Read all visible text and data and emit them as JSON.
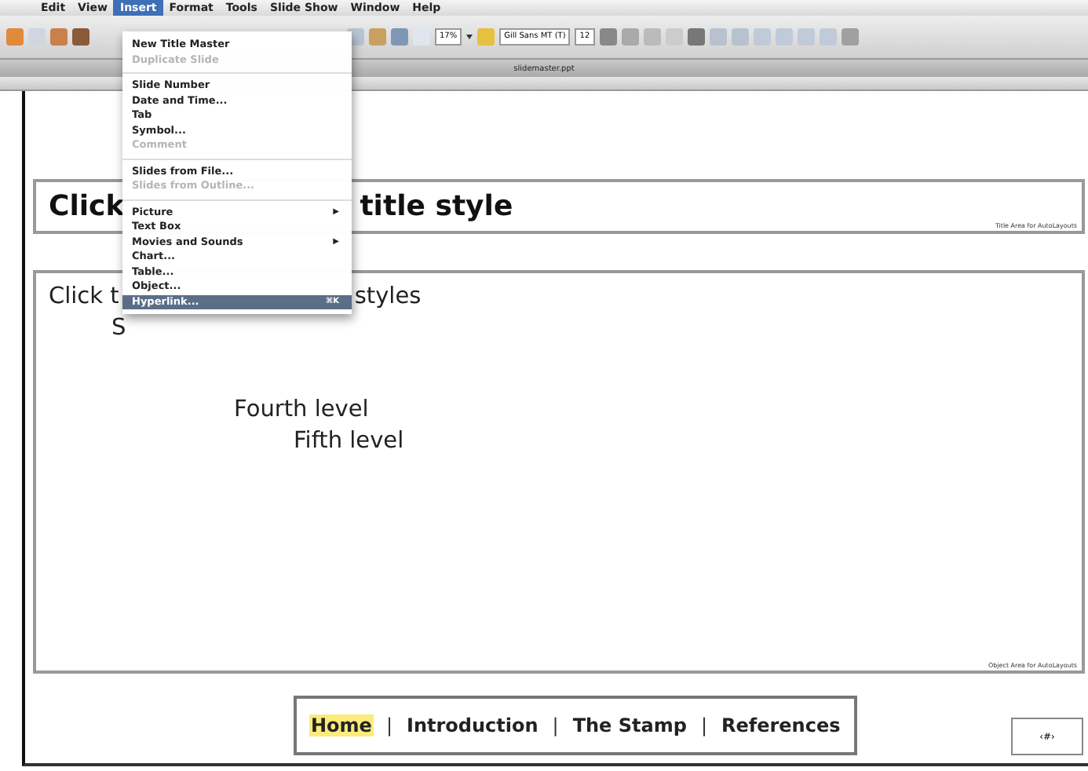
{
  "menubar": [
    {
      "label": "Edit",
      "selected": false
    },
    {
      "label": "View",
      "selected": false
    },
    {
      "label": "Insert",
      "selected": true
    },
    {
      "label": "Format",
      "selected": false
    },
    {
      "label": "Tools",
      "selected": false
    },
    {
      "label": "Slide Show",
      "selected": false
    },
    {
      "label": "Window",
      "selected": false
    },
    {
      "label": "Help",
      "selected": false
    }
  ],
  "toolbar": {
    "zoom": "17%",
    "font": "Gill Sans MT (T)",
    "size": "12"
  },
  "document_title": "slidemaster.ppt",
  "insert_menu": [
    {
      "kind": "item",
      "label": "New Title Master",
      "disabled": false,
      "selected": false
    },
    {
      "kind": "item",
      "label": "Duplicate Slide",
      "disabled": true,
      "selected": false
    },
    {
      "kind": "separator"
    },
    {
      "kind": "item",
      "label": "Slide Number",
      "disabled": false,
      "selected": false
    },
    {
      "kind": "item",
      "label": "Date and Time...",
      "disabled": false,
      "selected": false
    },
    {
      "kind": "item",
      "label": "Tab",
      "disabled": false,
      "selected": false
    },
    {
      "kind": "item",
      "label": "Symbol...",
      "disabled": false,
      "selected": false
    },
    {
      "kind": "item",
      "label": "Comment",
      "disabled": true,
      "selected": false
    },
    {
      "kind": "separator"
    },
    {
      "kind": "item",
      "label": "Slides from File...",
      "disabled": false,
      "selected": false
    },
    {
      "kind": "item",
      "label": "Slides from Outline...",
      "disabled": true,
      "selected": false
    },
    {
      "kind": "separator"
    },
    {
      "kind": "submenu",
      "label": "Picture",
      "arrow": "▶",
      "disabled": false,
      "selected": false
    },
    {
      "kind": "item",
      "label": "Text Box",
      "disabled": false,
      "selected": false
    },
    {
      "kind": "submenu",
      "label": "Movies and Sounds",
      "arrow": "▶",
      "disabled": false,
      "selected": false
    },
    {
      "kind": "item",
      "label": "Chart...",
      "disabled": false,
      "selected": false
    },
    {
      "kind": "item",
      "label": "Table...",
      "disabled": false,
      "selected": false
    },
    {
      "kind": "item",
      "label": "Object...",
      "disabled": false,
      "selected": false
    },
    {
      "kind": "item",
      "label": "Hyperlink...",
      "shortcut": "⌘K",
      "disabled": false,
      "selected": true
    }
  ],
  "title_placeholder": {
    "texts": [
      "Click",
      "title style"
    ],
    "area_label": "Title Area for AutoLayouts"
  },
  "body_placeholder": {
    "lines": [
      [
        "Click t",
        "styles"
      ],
      [
        "S"
      ],
      [
        "Fourth level"
      ],
      [
        "Fifth level"
      ]
    ],
    "area_label": "Object Area for AutoLayouts"
  },
  "navigation": {
    "links": [
      {
        "label": "Home",
        "selected": true
      },
      {
        "label": "Introduction",
        "selected": false
      },
      {
        "label": "The Stamp",
        "selected": false
      },
      {
        "label": "References",
        "selected": false
      }
    ],
    "separator": "|"
  },
  "page_number": "‹#›"
}
